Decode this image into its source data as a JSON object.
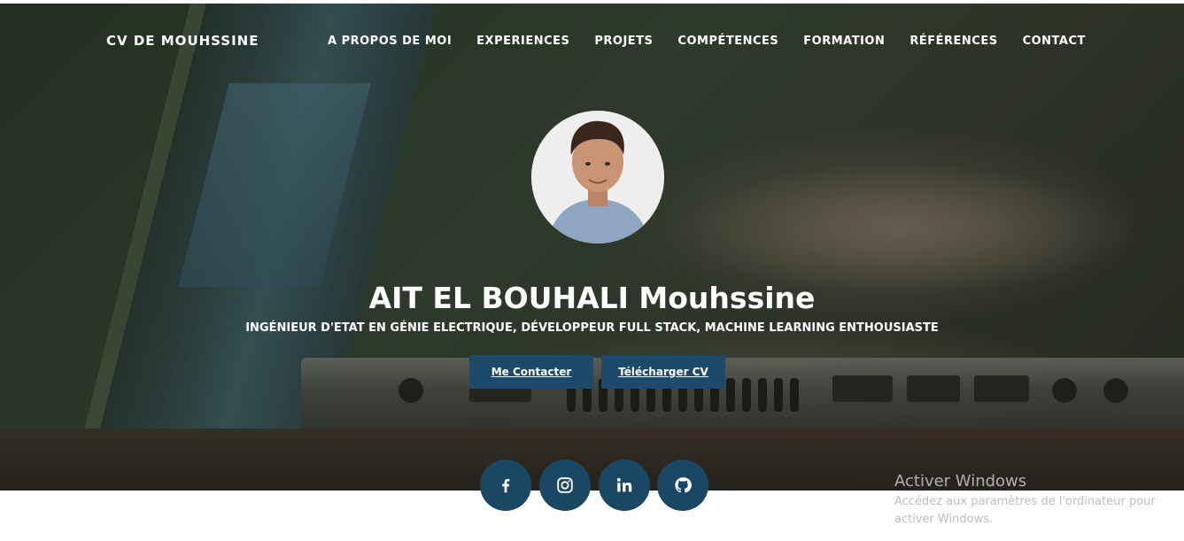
{
  "nav": {
    "brand": "CV DE MOUHSSINE",
    "items": [
      {
        "label": "A PROPOS DE MOI"
      },
      {
        "label": "EXPERIENCES"
      },
      {
        "label": "PROJETS"
      },
      {
        "label": "COMPÉTENCES"
      },
      {
        "label": "FORMATION"
      },
      {
        "label": "RÉFÉRENCES"
      },
      {
        "label": "CONTACT"
      }
    ]
  },
  "hero": {
    "name": "AIT EL BOUHALI Mouhssine",
    "subtitle": "INGÉNIEUR D'ETAT EN GÉNIE ELECTRIQUE, DÉVELOPPEUR FULL STACK, MACHINE LEARNING ENTHOUSIASTE",
    "buttons": {
      "contact": "Me Contacter",
      "download": "Télécharger CV"
    }
  },
  "social": {
    "icons": [
      "facebook-icon",
      "instagram-icon",
      "linkedin-icon",
      "github-icon"
    ],
    "color": "#1a4763"
  },
  "colors": {
    "button": "#1d4a6b",
    "nav_text": "#ffffff"
  },
  "watermark": {
    "title": "Activer Windows",
    "subtitle": "Accédez aux paramètres de l'ordinateur pour activer Windows."
  }
}
